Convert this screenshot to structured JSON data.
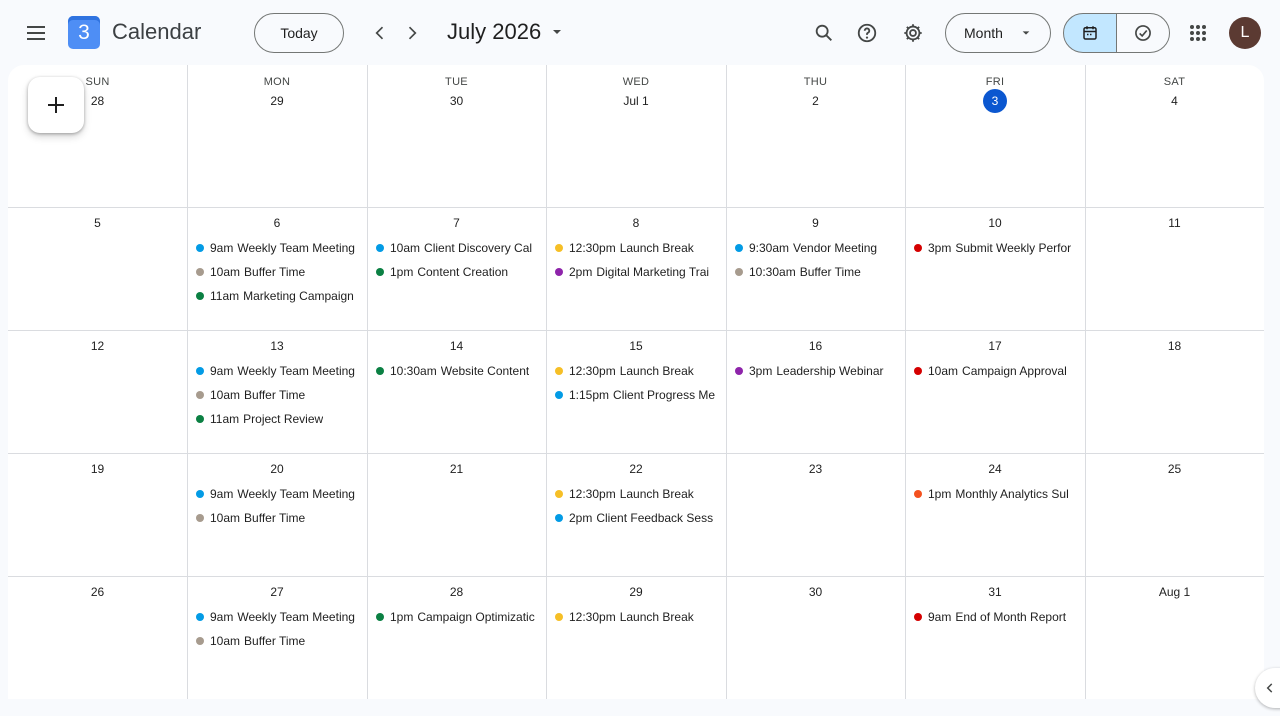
{
  "app": {
    "title": "Calendar",
    "logo_text": "3"
  },
  "header": {
    "today_label": "Today",
    "date_title": "July 2026",
    "view_label": "Month",
    "avatar_letter": "L"
  },
  "colors": {
    "today": "#0b57d0",
    "peacock": "#039be5",
    "graphite": "#a79b8e",
    "basil": "#0b8043",
    "banana": "#f6bf26",
    "grape": "#8e24aa",
    "tomato": "#d50000",
    "tangerine": "#f4511e"
  },
  "day_headers": [
    "SUN",
    "MON",
    "TUE",
    "WED",
    "THU",
    "FRI",
    "SAT"
  ],
  "weeks": [
    {
      "days": [
        {
          "label": "28",
          "events": []
        },
        {
          "label": "29",
          "events": []
        },
        {
          "label": "30",
          "events": []
        },
        {
          "label": "Jul 1",
          "events": []
        },
        {
          "label": "2",
          "events": []
        },
        {
          "label": "3",
          "today": true,
          "events": []
        },
        {
          "label": "4",
          "events": []
        }
      ]
    },
    {
      "days": [
        {
          "label": "5",
          "events": []
        },
        {
          "label": "6",
          "events": [
            {
              "time": "9am",
              "title": "Weekly Team Meeting",
              "color": "peacock"
            },
            {
              "time": "10am",
              "title": "Buffer Time",
              "color": "graphite"
            },
            {
              "time": "11am",
              "title": "Marketing Campaign",
              "color": "basil"
            }
          ]
        },
        {
          "label": "7",
          "events": [
            {
              "time": "10am",
              "title": "Client Discovery Cal",
              "color": "peacock"
            },
            {
              "time": "1pm",
              "title": "Content Creation",
              "color": "basil"
            }
          ]
        },
        {
          "label": "8",
          "events": [
            {
              "time": "12:30pm",
              "title": "Launch Break",
              "color": "banana"
            },
            {
              "time": "2pm",
              "title": "Digital Marketing Trai",
              "color": "grape"
            }
          ]
        },
        {
          "label": "9",
          "events": [
            {
              "time": "9:30am",
              "title": "Vendor Meeting",
              "color": "peacock"
            },
            {
              "time": "10:30am",
              "title": "Buffer Time",
              "color": "graphite"
            }
          ]
        },
        {
          "label": "10",
          "events": [
            {
              "time": "3pm",
              "title": "Submit Weekly Perfor",
              "color": "tomato"
            }
          ]
        },
        {
          "label": "11",
          "events": []
        }
      ]
    },
    {
      "days": [
        {
          "label": "12",
          "events": []
        },
        {
          "label": "13",
          "events": [
            {
              "time": "9am",
              "title": "Weekly Team Meeting",
              "color": "peacock"
            },
            {
              "time": "10am",
              "title": "Buffer Time",
              "color": "graphite"
            },
            {
              "time": "11am",
              "title": "Project Review",
              "color": "basil"
            }
          ]
        },
        {
          "label": "14",
          "events": [
            {
              "time": "10:30am",
              "title": "Website Content",
              "color": "basil"
            }
          ]
        },
        {
          "label": "15",
          "events": [
            {
              "time": "12:30pm",
              "title": "Launch Break",
              "color": "banana"
            },
            {
              "time": "1:15pm",
              "title": "Client Progress Me",
              "color": "peacock"
            }
          ]
        },
        {
          "label": "16",
          "events": [
            {
              "time": "3pm",
              "title": "Leadership Webinar",
              "color": "grape"
            }
          ]
        },
        {
          "label": "17",
          "events": [
            {
              "time": "10am",
              "title": "Campaign Approval",
              "color": "tomato"
            }
          ]
        },
        {
          "label": "18",
          "events": []
        }
      ]
    },
    {
      "days": [
        {
          "label": "19",
          "events": []
        },
        {
          "label": "20",
          "events": [
            {
              "time": "9am",
              "title": "Weekly Team Meeting",
              "color": "peacock"
            },
            {
              "time": "10am",
              "title": "Buffer Time",
              "color": "graphite"
            }
          ]
        },
        {
          "label": "21",
          "events": []
        },
        {
          "label": "22",
          "events": [
            {
              "time": "12:30pm",
              "title": "Launch Break",
              "color": "banana"
            },
            {
              "time": "2pm",
              "title": "Client Feedback Sess",
              "color": "peacock"
            }
          ]
        },
        {
          "label": "23",
          "events": []
        },
        {
          "label": "24",
          "events": [
            {
              "time": "1pm",
              "title": "Monthly Analytics Sul",
              "color": "tangerine"
            }
          ]
        },
        {
          "label": "25",
          "events": []
        }
      ]
    },
    {
      "days": [
        {
          "label": "26",
          "events": []
        },
        {
          "label": "27",
          "events": [
            {
              "time": "9am",
              "title": "Weekly Team Meeting",
              "color": "peacock"
            },
            {
              "time": "10am",
              "title": "Buffer Time",
              "color": "graphite"
            }
          ]
        },
        {
          "label": "28",
          "events": [
            {
              "time": "1pm",
              "title": "Campaign Optimizatic",
              "color": "basil"
            }
          ]
        },
        {
          "label": "29",
          "events": [
            {
              "time": "12:30pm",
              "title": "Launch Break",
              "color": "banana"
            }
          ]
        },
        {
          "label": "30",
          "events": []
        },
        {
          "label": "31",
          "events": [
            {
              "time": "9am",
              "title": "End of Month Report",
              "color": "tomato"
            }
          ]
        },
        {
          "label": "Aug 1",
          "events": []
        }
      ]
    }
  ],
  "icons": {
    "menu": "menu-icon",
    "prev": "chevron-left-icon",
    "next": "chevron-right-icon",
    "dropdown": "caret-down-icon",
    "search": "search-icon",
    "help": "help-icon",
    "settings": "gear-icon",
    "calendar_view": "calendar-icon",
    "tasks_view": "check-circle-icon",
    "apps": "apps-grid-icon",
    "create": "plus-icon",
    "side_panel": "chevron-left-icon"
  }
}
